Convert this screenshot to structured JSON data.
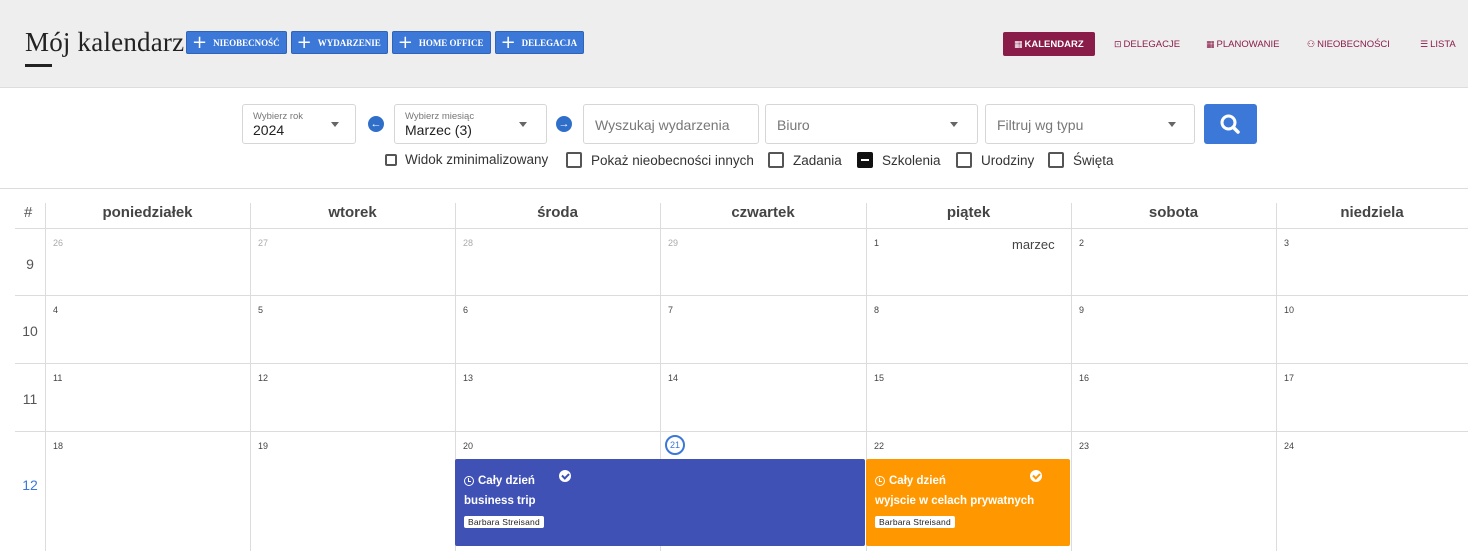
{
  "header": {
    "title": "Mój kalendarz",
    "add_buttons": [
      "NIEOBECNOŚĆ",
      "WYDARZENIE",
      "HOME OFFICE",
      "DELEGACJA"
    ],
    "nav": [
      "KALENDARZ",
      "DELEGACJE",
      "PLANOWANIE",
      "NIEOBECNOŚCI",
      "LISTA"
    ],
    "active_nav": "KALENDARZ"
  },
  "filters": {
    "year_label": "Wybierz rok",
    "year_value": "2024",
    "month_label": "Wybierz miesiąc",
    "month_value": "Marzec (3)",
    "search_placeholder": "Wyszukaj wydarzenia",
    "office_value": "Biuro",
    "type_placeholder": "Filtruj wg typu"
  },
  "checkboxes": [
    {
      "label": "Widok zminimalizowany",
      "checked": false
    },
    {
      "label": "Pokaż nieobecności innych",
      "checked": false
    },
    {
      "label": "Zadania",
      "checked": false
    },
    {
      "label": "Szkolenia",
      "checked": true
    },
    {
      "label": "Urodziny",
      "checked": false
    },
    {
      "label": "Święta",
      "checked": false
    }
  ],
  "calendar": {
    "hash": "#",
    "days": [
      "poniedziałek",
      "wtorek",
      "środa",
      "czwartek",
      "piątek",
      "sobota",
      "niedziela"
    ],
    "month_label": "marzec",
    "weeks": [
      {
        "num": "9",
        "dates": [
          "26",
          "27",
          "28",
          "29",
          "1",
          "2",
          "3"
        ]
      },
      {
        "num": "10",
        "dates": [
          "4",
          "5",
          "6",
          "7",
          "8",
          "9",
          "10"
        ]
      },
      {
        "num": "11",
        "dates": [
          "11",
          "12",
          "13",
          "14",
          "15",
          "16",
          "17"
        ]
      },
      {
        "num": "12",
        "dates": [
          "18",
          "19",
          "20",
          "21",
          "22",
          "23",
          "24"
        ]
      }
    ],
    "today": "21"
  },
  "events": [
    {
      "time": "Cały dzień",
      "title": "business trip",
      "person": "Barbara Streisand",
      "color": "#3f51b5"
    },
    {
      "time": "Cały dzień",
      "title": "wyjscie w celach prywatnych",
      "person": "Barbara Streisand",
      "color": "#ff9800"
    }
  ],
  "colors": {
    "primary": "#3c78d8",
    "nav_active": "#8a1c4a"
  }
}
